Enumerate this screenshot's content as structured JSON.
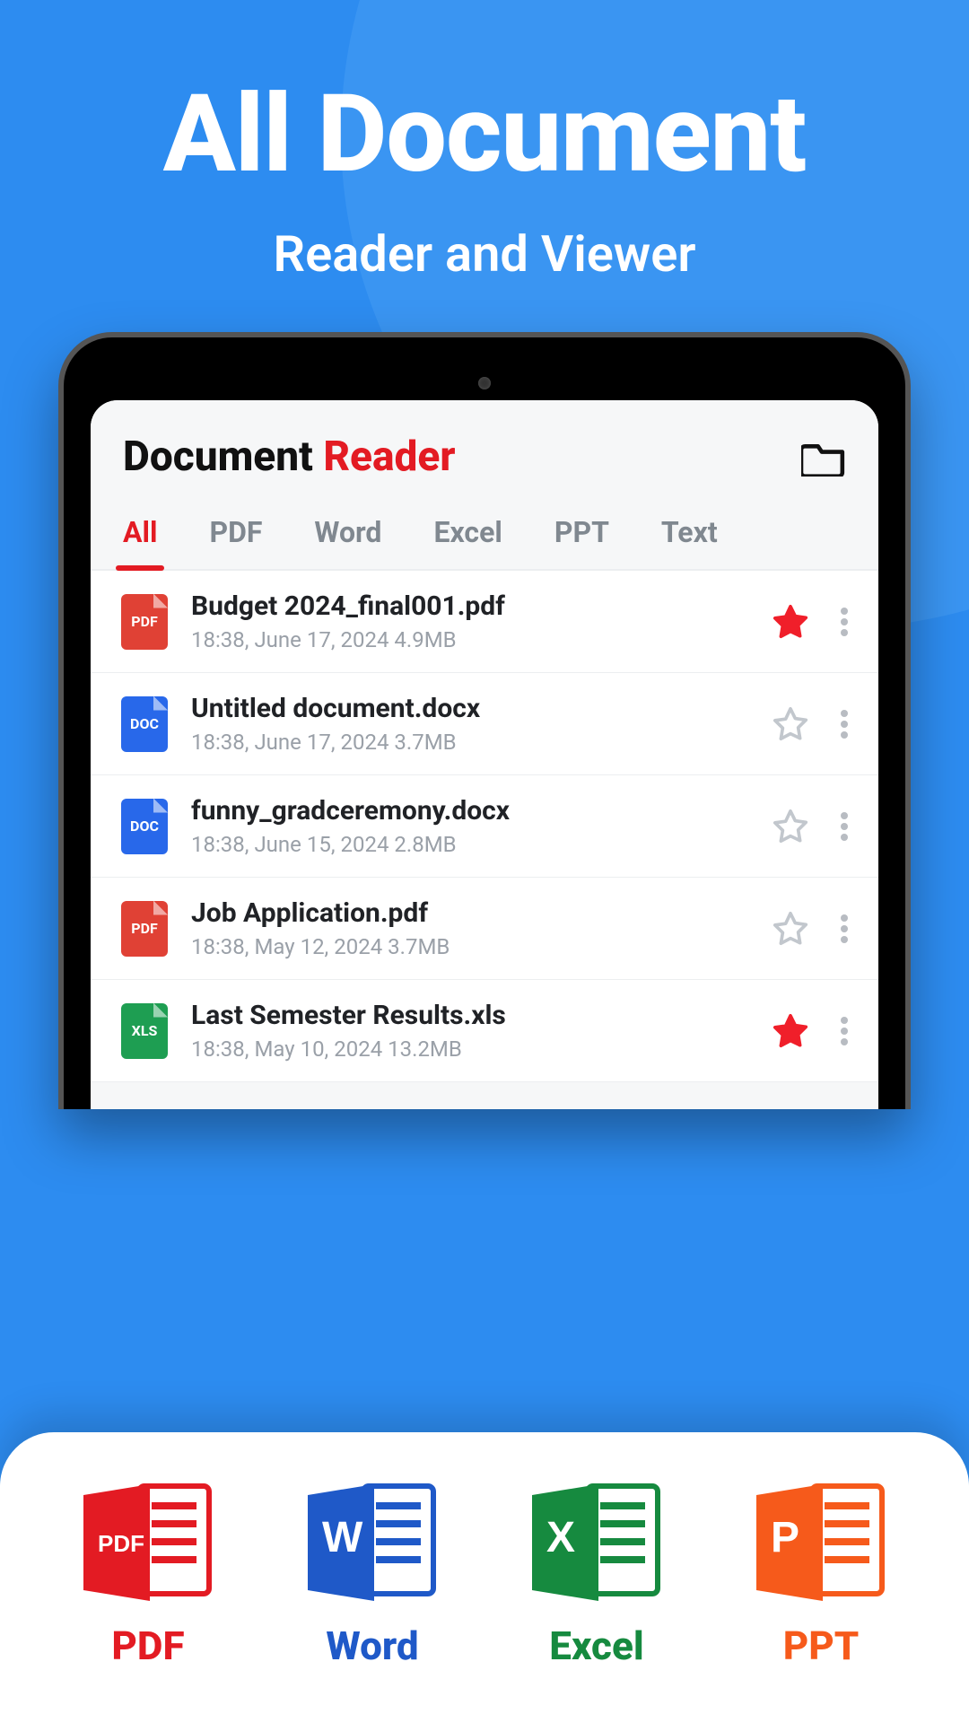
{
  "hero": {
    "title": "All Document",
    "subtitle": "Reader and Viewer"
  },
  "app": {
    "title_prefix": "Document",
    "title_suffix": "Reader"
  },
  "tabs": [
    "All",
    "PDF",
    "Word",
    "Excel",
    "PPT",
    "Text"
  ],
  "files": [
    {
      "icon": "PDF",
      "iconClass": "file-pdf",
      "name": "Budget 2024_final001.pdf",
      "meta": "18:38, June 17, 2024  4.9MB",
      "starred": true
    },
    {
      "icon": "DOC",
      "iconClass": "file-doc",
      "name": "Untitled document.docx",
      "meta": "18:38, June 17, 2024  3.7MB",
      "starred": false
    },
    {
      "icon": "DOC",
      "iconClass": "file-doc",
      "name": "funny_gradceremony.docx",
      "meta": "18:38, June 15, 2024  2.8MB",
      "starred": false
    },
    {
      "icon": "PDF",
      "iconClass": "file-pdf",
      "name": "Job Application.pdf",
      "meta": "18:38, May 12, 2024  3.7MB",
      "starred": false
    },
    {
      "icon": "XLS",
      "iconClass": "file-xls",
      "name": "Last Semester Results.xls",
      "meta": "18:38, May 10, 2024  13.2MB",
      "starred": true
    }
  ],
  "formats": [
    {
      "label": "PDF",
      "labelClass": "lbl-pdf",
      "badge": "PDF",
      "color": "#e31b23"
    },
    {
      "label": "Word",
      "labelClass": "lbl-word",
      "badge": "W",
      "color": "#1f59c8"
    },
    {
      "label": "Excel",
      "labelClass": "lbl-excel",
      "badge": "X",
      "color": "#168a3f"
    },
    {
      "label": "PPT",
      "labelClass": "lbl-ppt",
      "badge": "P",
      "color": "#f65a1b"
    }
  ]
}
